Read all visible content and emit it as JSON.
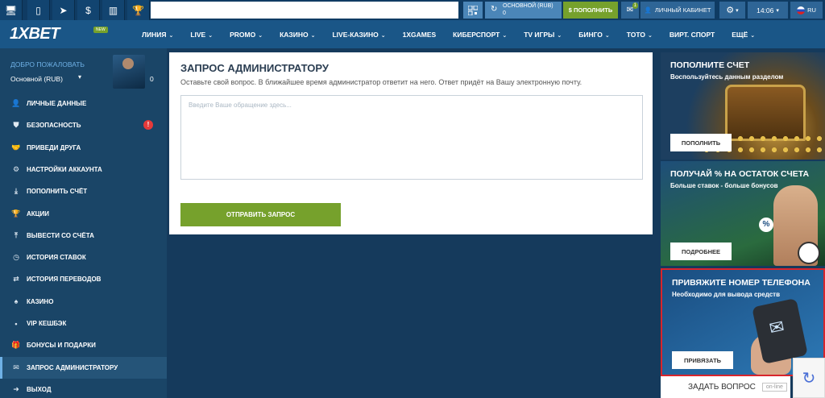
{
  "topbar": {
    "icons": [
      "desktop-icon",
      "mobile-icon",
      "telegram-icon",
      "dollar-icon",
      "chart-icon",
      "trophy-icon"
    ],
    "account_label": "ОСНОВНОЙ (RUB)",
    "balance": "0",
    "deposit_label": "$ ПОПОЛНИТЬ",
    "mail_count": "1",
    "cabinet_label": "ЛИЧНЫЙ КАБИНЕТ",
    "time": "14:06",
    "lang": "RU"
  },
  "nav": {
    "logo": "1XBET",
    "new_badge": "NEW",
    "items": [
      "ЛИНИЯ",
      "LIVE",
      "PROMO",
      "КАЗИНО",
      "LIVE-КАЗИНО",
      "1XGAMES",
      "КИБЕРСПОРТ",
      "TV ИГРЫ",
      "БИНГО",
      "ТОТО",
      "ВИРТ. СПОРТ",
      "ЕЩЁ"
    ],
    "has_chevron": [
      true,
      true,
      true,
      true,
      true,
      false,
      true,
      true,
      true,
      true,
      false,
      true
    ]
  },
  "sidebar": {
    "welcome": "ДОБРО ПОЖАЛОВАТЬ",
    "account": "Основной (RUB)",
    "balance": "0",
    "alert": "!",
    "items": [
      {
        "label": "ЛИЧНЫЕ ДАННЫЕ",
        "icon": "user-edit-icon"
      },
      {
        "label": "БЕЗОПАСНОСТЬ",
        "icon": "shield-icon"
      },
      {
        "label": "ПРИВЕДИ ДРУГА",
        "icon": "handshake-icon"
      },
      {
        "label": "НАСТРОЙКИ АККАУНТА",
        "icon": "gears-icon"
      },
      {
        "label": "ПОПОЛНИТЬ СЧЁТ",
        "icon": "download-icon"
      },
      {
        "label": "АКЦИИ",
        "icon": "trophy-icon"
      },
      {
        "label": "ВЫВЕСТИ СО СЧЁТА",
        "icon": "upload-icon"
      },
      {
        "label": "ИСТОРИЯ СТАВОК",
        "icon": "clock-icon"
      },
      {
        "label": "ИСТОРИЯ ПЕРЕВОДОВ",
        "icon": "transfer-icon"
      },
      {
        "label": "КАЗИНО",
        "icon": "cards-icon"
      },
      {
        "label": "VIP КЕШБЭК",
        "icon": "dot-icon"
      },
      {
        "label": "БОНУСЫ И ПОДАРКИ",
        "icon": "gift-icon"
      },
      {
        "label": "ЗАПРОС АДМИНИСТРАТОРУ",
        "icon": "envelope-icon"
      },
      {
        "label": "ВЫХОД",
        "icon": "exit-icon"
      }
    ]
  },
  "main": {
    "title": "ЗАПРОС АДМИНИСТРАТОРУ",
    "description": "Оставьте свой вопрос. В ближайшее время администратор ответит на него. Ответ придёт на Вашу электронную почту.",
    "placeholder": "Введите Ваше обращение здесь...",
    "send_label": "ОТПРАВИТЬ ЗАПРОС"
  },
  "banners": [
    {
      "title": "ПОПОЛНИТЕ СЧЕТ",
      "subtitle": "Воспользуйтесь данным разделом",
      "button": "ПОПОЛНИТЬ"
    },
    {
      "title": "ПОЛУЧАЙ % НА ОСТАТОК СЧЕТА",
      "subtitle": "Больше ставок - больше бонусов",
      "button": "ПОДРОБНЕЕ"
    },
    {
      "title": "ПРИВЯЖИТЕ НОМЕР ТЕЛЕФОНА",
      "subtitle": "Необходимо для вывода средств",
      "button": "ПРИВЯЗАТЬ"
    }
  ],
  "chat": {
    "label": "ЗАДАТЬ ВОПРОС",
    "status": "on-line"
  },
  "colors": {
    "accent_green": "#76a12c",
    "nav_blue": "#1a5687",
    "sidebar_bg": "#1a4567",
    "alert_red": "#e53a3a"
  }
}
